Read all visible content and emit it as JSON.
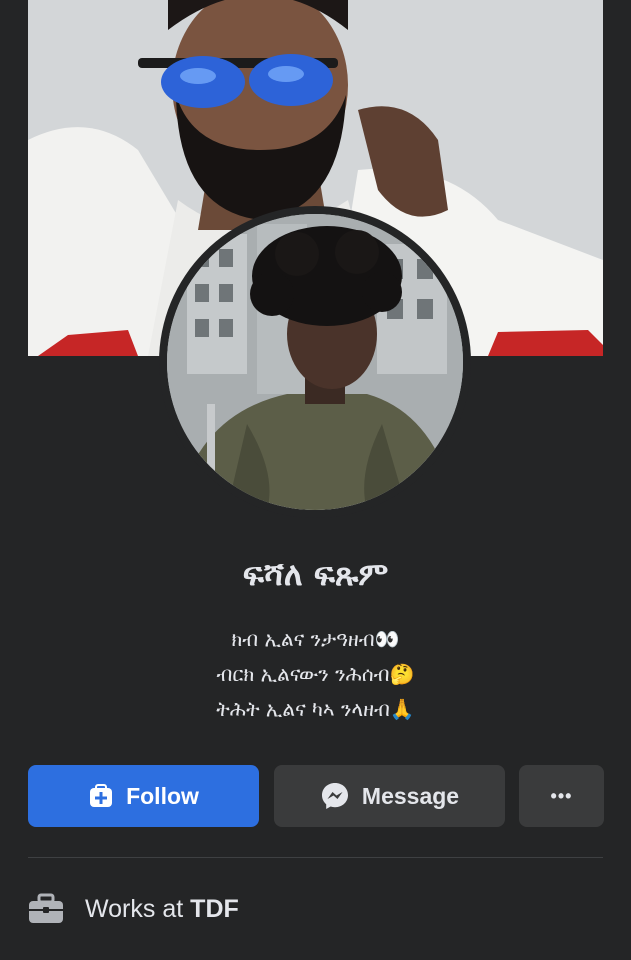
{
  "profile": {
    "name": "ፍሻለ ፍጹም",
    "bio": [
      "ክብ ኢልና ንታዓዘብ👀",
      "ብርክ ኢልናውን ንሕሰብ🤔",
      "ትሕት ኢልና ካኣ ንላዘብ🙏"
    ]
  },
  "actions": {
    "follow_label": "Follow",
    "message_label": "Message",
    "more_label": "•••"
  },
  "about": {
    "works_prefix": "Works at",
    "works_org": "TDF"
  },
  "colors": {
    "background": "#242526",
    "follow_button": "#2d6fe0",
    "secondary_button": "#3a3b3c",
    "text": "#e4e6eb"
  },
  "icons": {
    "follow": "add-friend-icon",
    "message": "messenger-icon",
    "more": "more-icon",
    "work": "briefcase-icon"
  }
}
